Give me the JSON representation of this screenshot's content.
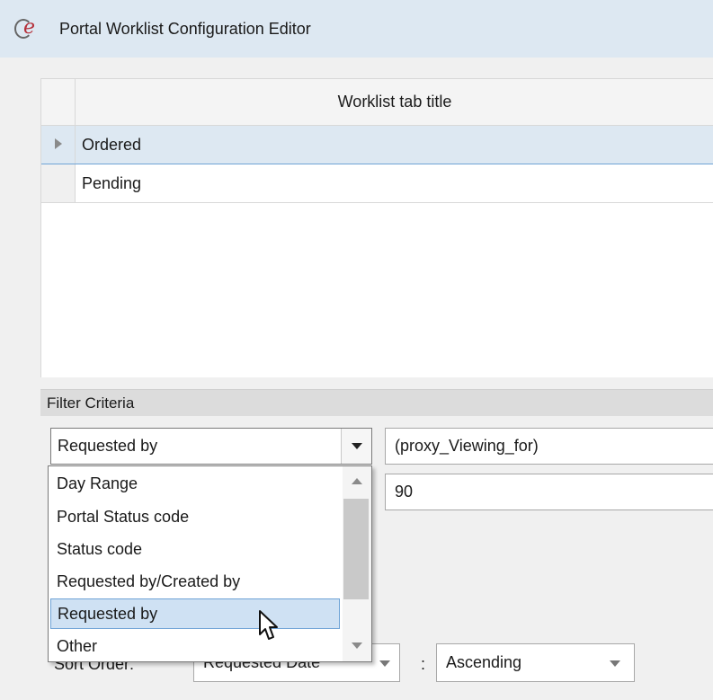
{
  "window": {
    "title": "Portal Worklist Configuration Editor",
    "logo_icon": "ce-logo-icon"
  },
  "grid": {
    "column_header": "Worklist tab title",
    "rows": [
      {
        "title": "Ordered",
        "current": true
      },
      {
        "title": "Pending",
        "current": false
      }
    ]
  },
  "filter": {
    "section_title": "Filter Criteria",
    "criteria_selected": "Requested by",
    "criteria_value": "(proxy_Viewing_for)",
    "day_range_value": "90",
    "dropdown_options": [
      "Day Range",
      "Portal Status code",
      "Status code",
      "Requested by/Created by",
      "Requested by",
      "Other"
    ],
    "dropdown_highlighted": "Requested by"
  },
  "sort": {
    "label": "Sort Order:",
    "field": "Requested Date",
    "separator": ":",
    "direction": "Ascending"
  },
  "colors": {
    "selection_bg": "#dde8f2",
    "selection_border": "#6fa3d6",
    "logo_red": "#b5303a"
  }
}
